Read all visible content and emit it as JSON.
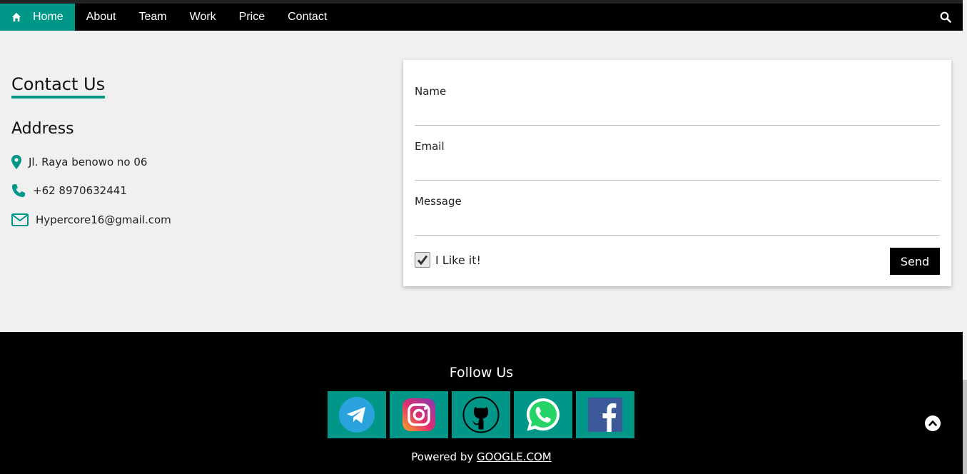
{
  "nav": {
    "items": [
      {
        "label": "Home",
        "active": true
      },
      {
        "label": "About"
      },
      {
        "label": "Team"
      },
      {
        "label": "Work"
      },
      {
        "label": "Price"
      },
      {
        "label": "Contact"
      }
    ],
    "search_icon": "search-icon"
  },
  "contact": {
    "title": "Contact Us",
    "address_heading": "Address",
    "address": "Jl. Raya benowo no 06",
    "phone": "+62 8970632441",
    "email": "Hypercore16@gmail.com"
  },
  "form": {
    "name_label": "Name",
    "email_label": "Email",
    "message_label": "Message",
    "checkbox_label": "I Like it!",
    "checkbox_checked": true,
    "send_label": "Send"
  },
  "footer": {
    "follow_title": "Follow Us",
    "social": [
      "telegram-icon",
      "instagram-icon",
      "github-icon",
      "whatsapp-icon",
      "facebook-icon"
    ],
    "powered_prefix": "Powered by",
    "powered_link": "GOOGLE.COM"
  },
  "colors": {
    "accent": "#009688",
    "nav_bg": "#000000",
    "page_bg": "#f0f0f0"
  }
}
